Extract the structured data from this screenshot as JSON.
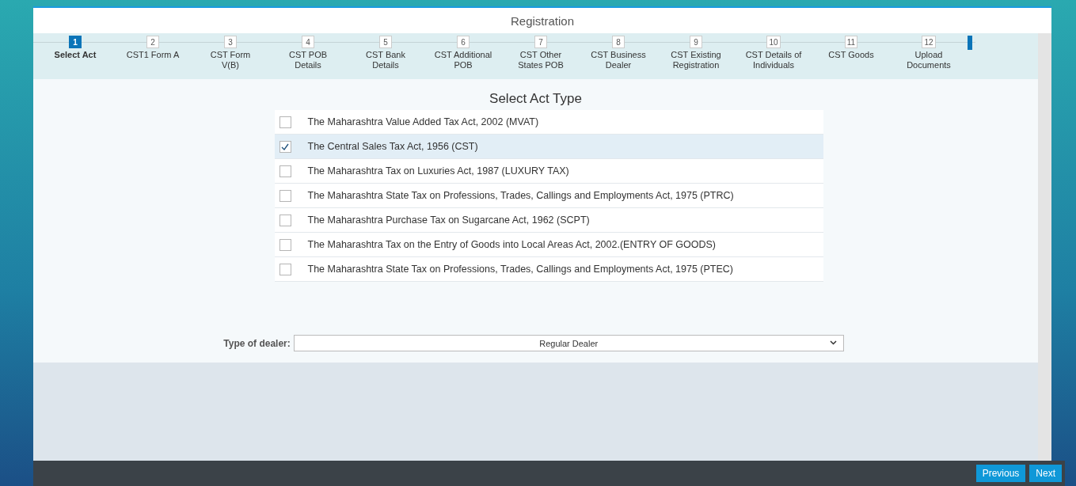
{
  "window": {
    "title": "Registration"
  },
  "steps": [
    {
      "number": "1",
      "label": "Select Act",
      "selected": true
    },
    {
      "number": "2",
      "label": "CST1 Form A",
      "selected": false
    },
    {
      "number": "3",
      "label": "CST Form V(B)",
      "selected": false
    },
    {
      "number": "4",
      "label": "CST POB Details",
      "selected": false
    },
    {
      "number": "5",
      "label": "CST Bank Details",
      "selected": false
    },
    {
      "number": "6",
      "label": "CST Additional POB",
      "selected": false
    },
    {
      "number": "7",
      "label": "CST Other States POB",
      "selected": false
    },
    {
      "number": "8",
      "label": "CST Business Dealer",
      "selected": false
    },
    {
      "number": "9",
      "label": "CST Existing Registration",
      "selected": false
    },
    {
      "number": "10",
      "label": "CST Details of Individuals",
      "selected": false
    },
    {
      "number": "11",
      "label": "CST Goods",
      "selected": false
    },
    {
      "number": "12",
      "label": "Upload Documents",
      "selected": false
    }
  ],
  "act_section": {
    "title": "Select Act Type",
    "acts": [
      {
        "label": "The Maharashtra Value Added Tax Act, 2002 (MVAT)",
        "checked": false
      },
      {
        "label": "The Central Sales Tax Act, 1956 (CST)",
        "checked": true
      },
      {
        "label": "The Maharashtra Tax on Luxuries Act, 1987 (LUXURY TAX)",
        "checked": false
      },
      {
        "label": "The Maharashtra State Tax on Professions, Trades, Callings and Employments Act, 1975 (PTRC)",
        "checked": false
      },
      {
        "label": "The Maharashtra Purchase Tax on Sugarcane Act, 1962 (SCPT)",
        "checked": false
      },
      {
        "label": "The Maharashtra Tax on the Entry of Goods into Local Areas Act, 2002.(ENTRY OF GOODS)",
        "checked": false
      },
      {
        "label": "The Maharashtra State Tax on Professions, Trades, Callings and Employments Act, 1975 (PTEC)",
        "checked": false
      }
    ]
  },
  "dealer": {
    "label": "Type of dealer:",
    "value": "Regular Dealer"
  },
  "footer": {
    "buttons": [
      "Previous",
      "Next"
    ]
  }
}
